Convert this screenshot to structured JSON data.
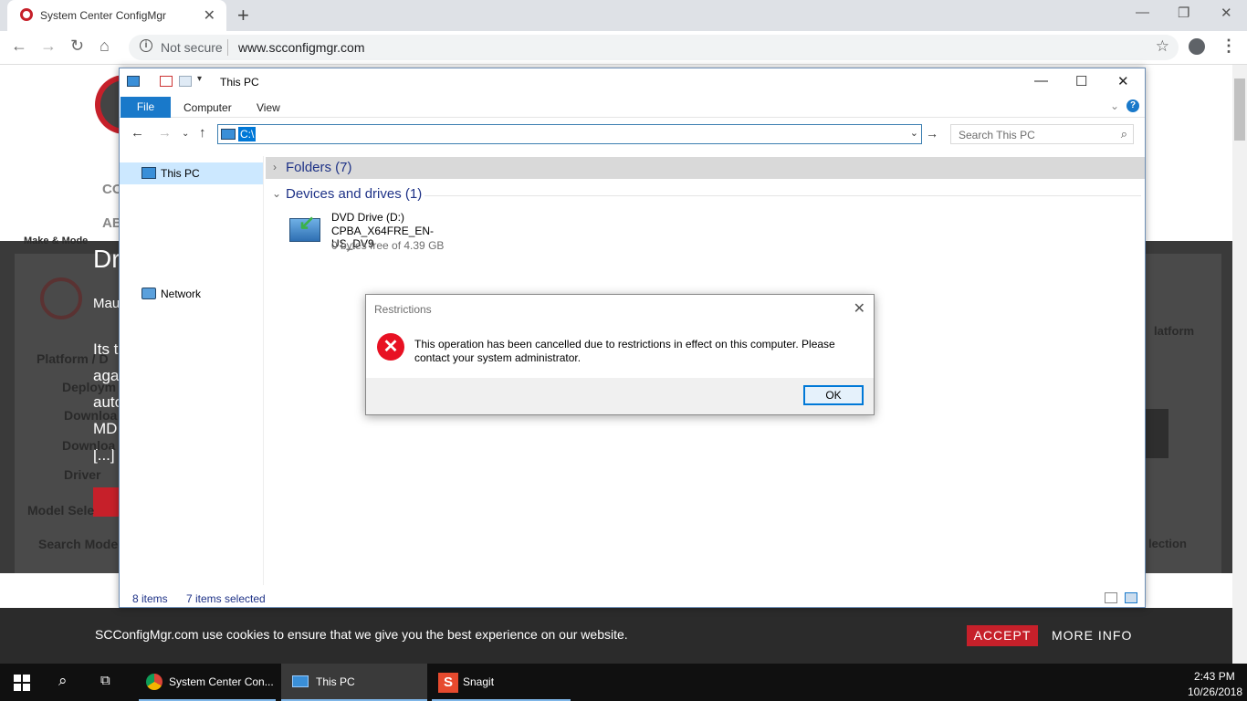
{
  "browser": {
    "tab_title": "System Center ConfigMgr",
    "security_label": "Not secure",
    "url": "www.scconfigmgr.com"
  },
  "background_page": {
    "fragments": [
      "CO",
      "AB",
      "Dr",
      "Mau",
      "Its t",
      "aga",
      "auto",
      "MD",
      "[...]"
    ],
    "dim_fragments": [
      "Make & Mode",
      "Platform / D",
      "Deploym",
      "Downloa",
      "Downloa",
      "Driver",
      "Model Sele",
      "Search Mode",
      "latform",
      "lection"
    ]
  },
  "cookie_banner": {
    "message": "SCConfigMgr.com use cookies to ensure that we give you the best experience on our website.",
    "accept_label": "ACCEPT",
    "more_info_label": "MORE INFO",
    "accent_color": "#c6202a"
  },
  "explorer": {
    "title": "This PC",
    "ribbon_tabs": [
      "File",
      "Computer",
      "View"
    ],
    "address_value": "C:\\",
    "search_placeholder": "Search This PC",
    "nav": [
      {
        "label": "This PC",
        "icon": "this-pc-icon",
        "selected": true
      },
      {
        "label": "Network",
        "icon": "network-icon",
        "selected": false
      }
    ],
    "groups": {
      "folders_label": "Folders (7)",
      "devices_label": "Devices and drives (1)"
    },
    "drive": {
      "name": "DVD Drive (D:)",
      "volume_label": "CPBA_X64FRE_EN-US_DV9",
      "free_space": "0 bytes free of 4.39 GB"
    },
    "status": {
      "items": "8 items",
      "selected": "7 items selected"
    }
  },
  "dialog": {
    "title": "Restrictions",
    "message": "This operation has been cancelled due to restrictions in effect on this computer. Please contact your system administrator.",
    "ok_label": "OK",
    "icon": "error-icon"
  },
  "taskbar": {
    "items": [
      {
        "label": "System Center Con...",
        "icon": "chrome-icon"
      },
      {
        "label": "This PC",
        "icon": "file-explorer-icon"
      },
      {
        "label": "Snagit",
        "icon": "snagit-icon"
      }
    ],
    "time": "2:43 PM",
    "date": "10/26/2018"
  }
}
